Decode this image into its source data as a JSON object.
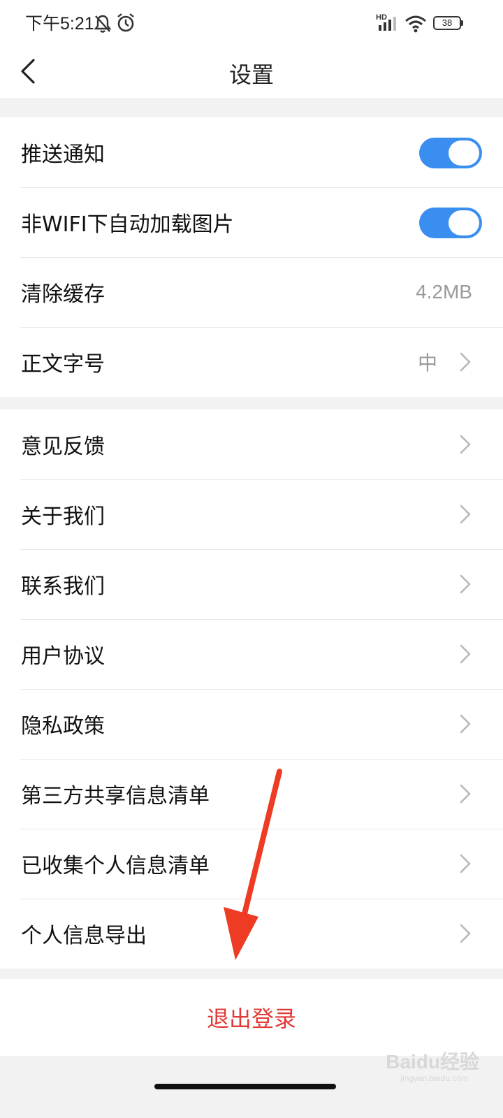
{
  "status_bar": {
    "time": "下午5:21",
    "network_label": "HD",
    "battery_level": "38",
    "icons": [
      "mute-bell-icon",
      "alarm-icon",
      "signal-icon",
      "wifi-icon",
      "battery-icon"
    ]
  },
  "header": {
    "title": "设置",
    "back_icon": "chevron-left-icon"
  },
  "section1": {
    "push_notifications": {
      "label": "推送通知",
      "enabled": true
    },
    "autoload_images": {
      "label": "非WIFI下自动加载图片",
      "enabled": true
    },
    "clear_cache": {
      "label": "清除缓存",
      "value": "4.2MB"
    },
    "font_size": {
      "label": "正文字号",
      "value": "中"
    }
  },
  "section2": {
    "items": [
      {
        "label": "意见反馈"
      },
      {
        "label": "关于我们"
      },
      {
        "label": "联系我们"
      },
      {
        "label": "用户协议"
      },
      {
        "label": "隐私政策"
      },
      {
        "label": "第三方共享信息清单"
      },
      {
        "label": "已收集个人信息清单"
      },
      {
        "label": "个人信息导出"
      }
    ]
  },
  "logout": {
    "label": "退出登录"
  },
  "watermark": {
    "text": "Baidu经验",
    "sub": "jingyan.baidu.com"
  },
  "colors": {
    "accent_blue": "#3a8ef0",
    "logout_red": "#e23a36",
    "annotation_arrow": "#ee3b24",
    "background": "#f2f2f2"
  }
}
